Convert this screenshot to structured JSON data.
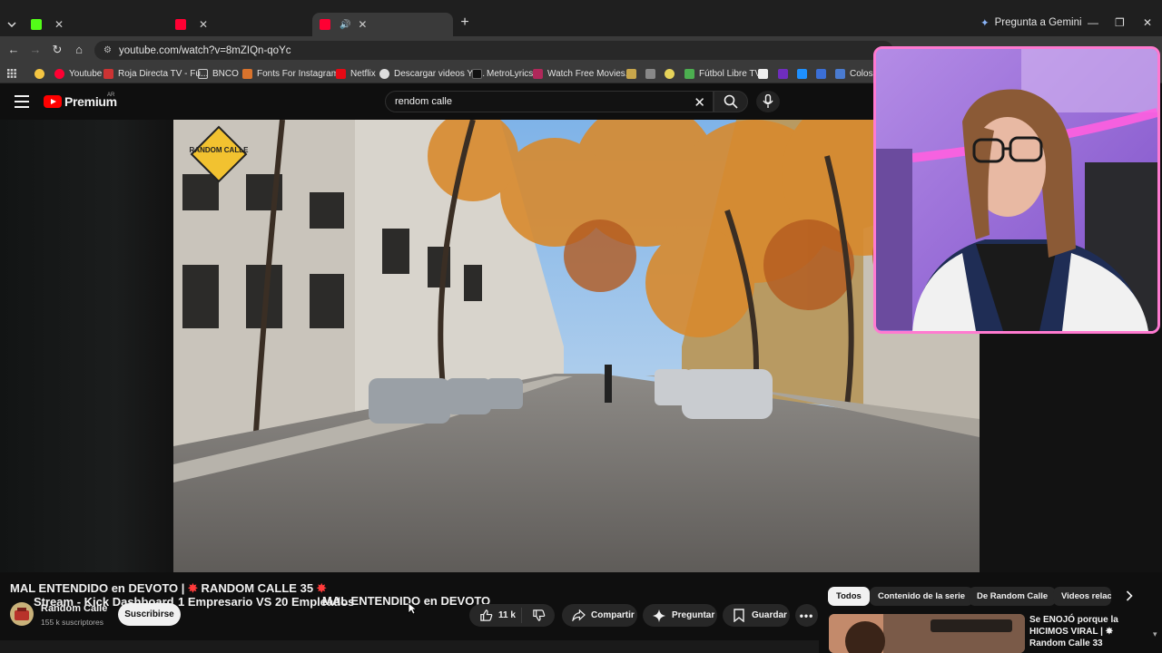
{
  "browser": {
    "tabs": [
      {
        "title": "Stream - Kick Dashboard",
        "favicon": "kick-icon",
        "active": false
      },
      {
        "title": "1 Empresario VS 20 Empleados",
        "favicon": "youtube-icon",
        "active": false
      },
      {
        "title": "MAL ENTENDIDO en DEVOTO",
        "favicon": "youtube-icon",
        "active": true
      }
    ],
    "gemini_label": "Pregunta a Gemini",
    "url": "youtube.com/watch?v=8mZIQn-qoYc",
    "bookmarks": [
      {
        "label": "",
        "icon": "emoji-icon"
      },
      {
        "label": "Youtube",
        "icon": "youtube-icon"
      },
      {
        "label": "Roja Directa TV - Fu...",
        "icon": "rojadirecta-icon"
      },
      {
        "label": "BNCO",
        "icon": "folder-icon"
      },
      {
        "label": "Fonts For Instagram...",
        "icon": "fonts-icon"
      },
      {
        "label": "Netflix",
        "icon": "netflix-icon"
      },
      {
        "label": "Descargar videos Yo...",
        "icon": "download-icon"
      },
      {
        "label": "MetroLyrics",
        "icon": "metrolyrics-icon"
      },
      {
        "label": "Watch Free Movies...",
        "icon": "movies-icon"
      },
      {
        "label": "Fútbol Libre TV",
        "icon": "futbol-icon"
      },
      {
        "label": "Colossa",
        "icon": "colossal-icon"
      }
    ],
    "colors": {
      "tabbar": "#1f1f1f",
      "toolbar": "#3a3a3a",
      "accent_red": "#ff0000"
    }
  },
  "youtube": {
    "logo_text": "Premium",
    "country_code": "AR",
    "search_query": "rendom calle",
    "video": {
      "title_prefix": "MAL ENTENDIDO en DEVOTO | ",
      "title_main": "RANDOM CALLE 35",
      "spark": "✸",
      "watermark": "RANDOM CALLE"
    },
    "channel": {
      "name": "Random Calle",
      "subscribers": "155 k suscriptores",
      "subscribe_label": "Suscribirse"
    },
    "actions": {
      "likes": "11 k",
      "share": "Compartir",
      "ask": "Preguntar",
      "save": "Guardar"
    },
    "chips": [
      "Todos",
      "Contenido de la serie",
      "De Random Calle",
      "Videos relac"
    ],
    "recommendation": {
      "title": "Se ENOJÓ porque la HICIMOS VIRAL | ✸ Random Calle 33"
    }
  }
}
